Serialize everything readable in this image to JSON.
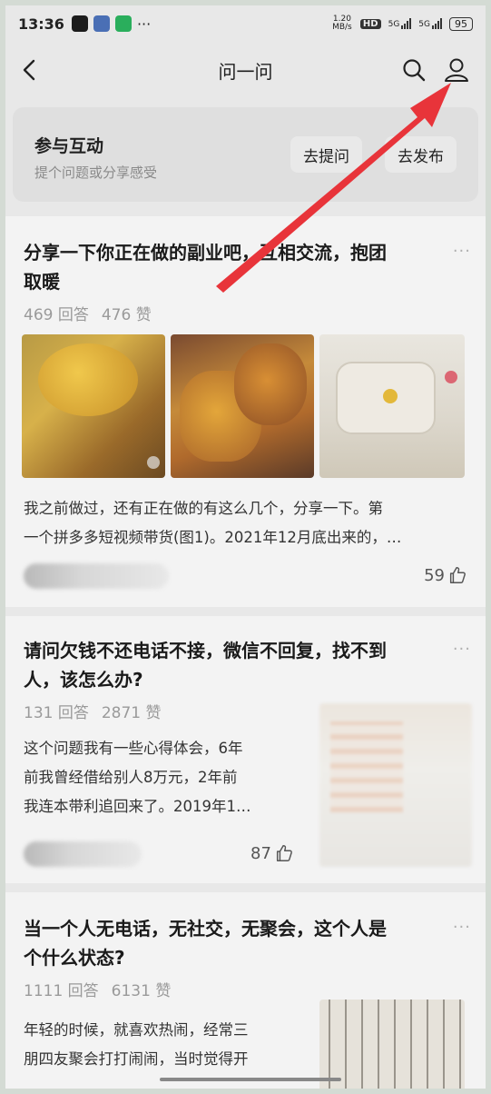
{
  "status_bar": {
    "time": "13:36",
    "dots": "···",
    "net_speed": "1.20\nMB/s",
    "hd": "HD",
    "sig1": "5G",
    "sig2": "5G",
    "battery": "95"
  },
  "nav": {
    "title": "问一问",
    "icons": [
      "back-arrow-icon",
      "search-icon",
      "user-icon"
    ]
  },
  "interact": {
    "heading": "参与互动",
    "subtitle": "提个问题或分享感受",
    "ask_label": "去提问",
    "post_label": "去发布"
  },
  "feed": [
    {
      "title_line1": "分享一下你正在做的副业吧，互相交流，抱团",
      "title_line2": "取暖",
      "answers": "469 回答",
      "likes_count": "476 赞",
      "excerpt_line1": "我之前做过，还有正在做的有这么几个，分享一下。第",
      "excerpt_line2": "一个拼多多短视频带货(图1)。2021年12月底出来的，…",
      "like_value": "59"
    },
    {
      "title_line1": "请问欠钱不还电话不接，微信不回复，找不到",
      "title_line2": "人，该怎么办?",
      "answers": "131 回答",
      "likes_count": "2871 赞",
      "excerpt_line1": "这个问题我有一些心得体会，6年",
      "excerpt_line2": "前我曾经借给别人8万元，2年前",
      "excerpt_line3": "我连本带利追回来了。2019年1…",
      "like_value": "87"
    },
    {
      "title_line1": "当一个人无电话，无社交，无聚会，这个人是",
      "title_line2": "个什么状态?",
      "answers": "1111 回答",
      "likes_count": "6131 赞",
      "excerpt_line1": "年轻的时候，就喜欢热闹，经常三",
      "excerpt_line2": "朋四友聚会打打闹闹，当时觉得开"
    }
  ],
  "more_glyph": "···",
  "colors": {
    "arrow": "#e8343a",
    "background": "#e8e8e8"
  }
}
